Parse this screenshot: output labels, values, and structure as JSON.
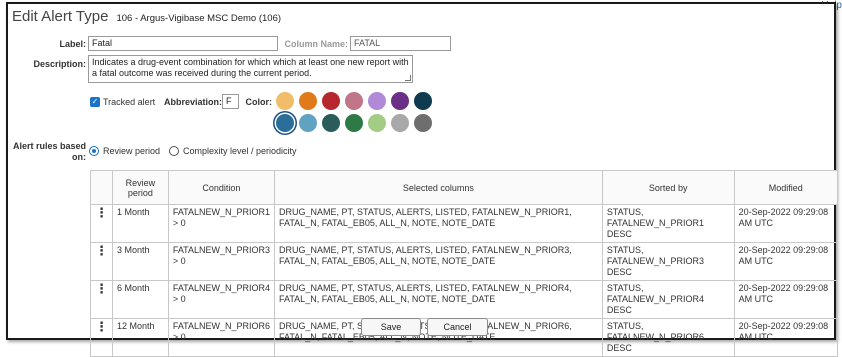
{
  "help_link": "Help",
  "dialog": {
    "title": "Edit Alert Type",
    "subtitle": "106 - Argus-Vigibase MSC Demo (106)"
  },
  "form": {
    "label_label": "Label:",
    "label_value": "Fatal",
    "column_name_label": "Column Name:",
    "column_name_value": "FATAL",
    "description_label": "Description:",
    "description_value": "Indicates a drug-event combination for which which at least one new report with a fatal outcome was received during the current period.",
    "tracked_alert_label": "Tracked alert",
    "tracked_alert_checked": true,
    "abbreviation_label": "Abbreviation:",
    "abbreviation_value": "F",
    "color_label": "Color:",
    "colors_row1": [
      "#f2bd6b",
      "#e07a1a",
      "#b7282e",
      "#c07589",
      "#b08ad6",
      "#6b2f86",
      "#0f3a4f"
    ],
    "colors_row2": [
      "#2a6f9a",
      "#5fa3c0",
      "#2a5c5c",
      "#2e7a46",
      "#a3cc85",
      "#a8a8a8",
      "#6e6e6e"
    ],
    "selected_color": "#2a6f9a",
    "rules_label": "Alert rules based on:",
    "rule_option_review": "Review period",
    "rule_option_complexity": "Complexity level / periodicity",
    "rule_selected": "Review period"
  },
  "table": {
    "headers": [
      "",
      "Review period",
      "Condition",
      "Selected columns",
      "Sorted by",
      "Modified"
    ],
    "rows": [
      {
        "period": "1 Month",
        "condition": "FATALNEW_N_PRIOR1 > 0",
        "columns": "DRUG_NAME, PT, STATUS, ALERTS, LISTED, FATALNEW_N_PRIOR1, FATAL_N, FATAL_EB05, ALL_N, NOTE, NOTE_DATE",
        "sorted": "STATUS, FATALNEW_N_PRIOR1 DESC",
        "modified": "20-Sep-2022 09:29:08 AM UTC"
      },
      {
        "period": "3 Month",
        "condition": "FATALNEW_N_PRIOR3 > 0",
        "columns": "DRUG_NAME, PT, STATUS, ALERTS, LISTED, FATALNEW_N_PRIOR3, FATAL_N, FATAL_EB05, ALL_N, NOTE, NOTE_DATE",
        "sorted": "STATUS, FATALNEW_N_PRIOR3 DESC",
        "modified": "20-Sep-2022 09:29:08 AM UTC"
      },
      {
        "period": "6 Month",
        "condition": "FATALNEW_N_PRIOR4 > 0",
        "columns": "DRUG_NAME, PT, STATUS, ALERTS, LISTED, FATALNEW_N_PRIOR4, FATAL_N, FATAL_EB05, ALL_N, NOTE, NOTE_DATE",
        "sorted": "STATUS, FATALNEW_N_PRIOR4 DESC",
        "modified": "20-Sep-2022 09:29:08 AM UTC"
      },
      {
        "period": "12 Month",
        "condition": "FATALNEW_N_PRIOR6 > 0",
        "columns": "DRUG_NAME, PT, STATUS, ALERTS, LISTED, FATALNEW_N_PRIOR6, FATAL_N, FATAL_EB05, ALL_N, NOTE, NOTE_DATE",
        "sorted": "STATUS, FATALNEW_N_PRIOR6 DESC",
        "modified": "20-Sep-2022 09:29:08 AM UTC"
      }
    ],
    "row_menu_icon": "kebab-menu-icon"
  },
  "buttons": {
    "save": "Save",
    "cancel": "Cancel"
  }
}
